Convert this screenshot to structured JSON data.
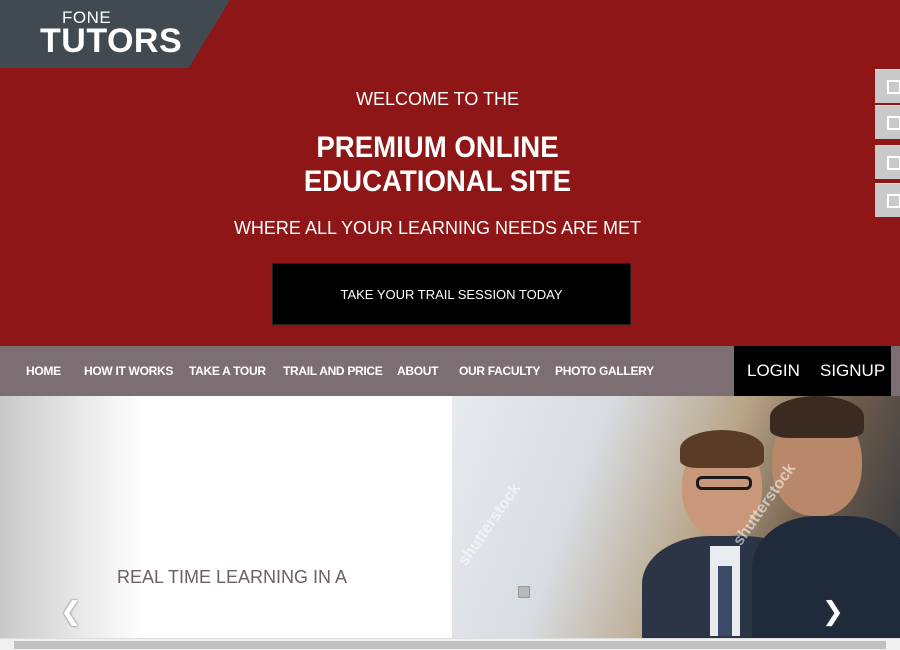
{
  "logo": {
    "small": "FONE",
    "big": "TUTORS"
  },
  "hero": {
    "welcome": "WELCOME TO THE",
    "title_line1": "PREMIUM ONLINE",
    "title_line2": "EDUCATIONAL SITE",
    "subtitle": "WHERE ALL YOUR LEARNING NEEDS ARE MET",
    "cta_label": "TAKE YOUR TRAIL SESSION TODAY",
    "background": "#8e1616"
  },
  "nav": {
    "items": [
      {
        "label": "HOME"
      },
      {
        "label": "HOW IT WORKS"
      },
      {
        "label": "TAKE A TOUR"
      },
      {
        "label": "TRAIL AND PRICE"
      },
      {
        "label": "ABOUT"
      },
      {
        "label": "OUR FACULTY"
      },
      {
        "label": "PHOTO GALLERY"
      }
    ],
    "login": "LOGIN",
    "signup": "SIGNUP",
    "background": "#7d6e73"
  },
  "slider": {
    "caption": "REAL TIME LEARNING IN A",
    "prev_icon": "chevron-left-icon",
    "next_icon": "chevron-right-icon",
    "watermark": "shutterstock"
  },
  "side_buttons": {
    "count": 4,
    "icon": "square-icon"
  }
}
